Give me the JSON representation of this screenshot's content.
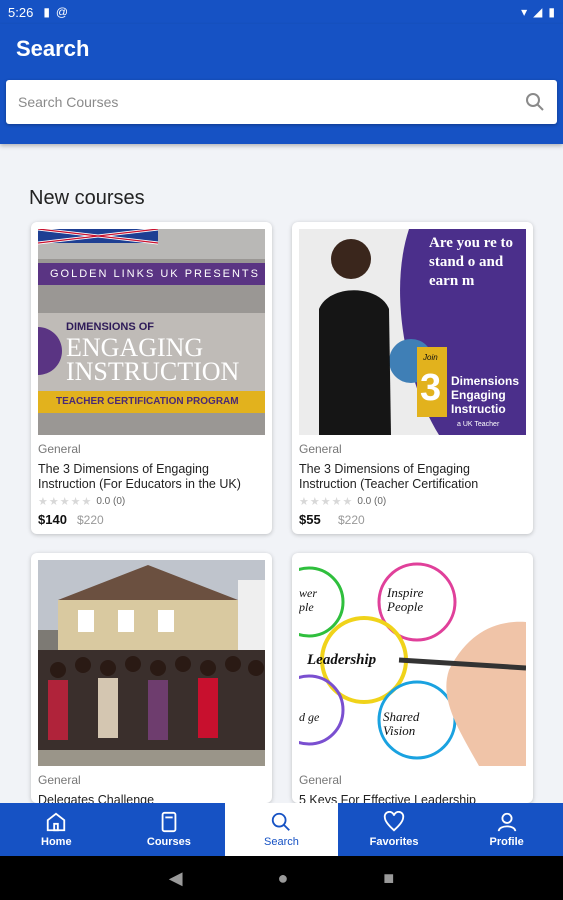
{
  "status": {
    "time": "5:26"
  },
  "header": {
    "title": "Search",
    "search_placeholder": "Search Courses"
  },
  "section": {
    "title": "New courses"
  },
  "courses": [
    {
      "category": "General",
      "title": "The 3 Dimensions of Engaging Instruction (For Educators in the UK)",
      "rating": "0.0 (0)",
      "price": "$140",
      "old_price": "$220",
      "thumb": {
        "banner_top": "GOLDEN LINKS UK PRESENTS",
        "line1": "DIMENSIONS OF",
        "line2": "ENGAGING",
        "line3": "INSTRUCTION",
        "footer": "TEACHER CERTIFICATION PROGRAM"
      }
    },
    {
      "category": "General",
      "title": "The 3 Dimensions of Engaging Instruction (Teacher Certification",
      "rating": "0.0 (0)",
      "price": "$55",
      "old_price": "$220",
      "thumb": {
        "headline": "Are you re to stand o and earn m",
        "join": "Join",
        "num": "3",
        "sub": "Dimensions Engaging Instructio",
        "small": "a UK Teacher"
      }
    },
    {
      "category": "General",
      "title": "Delegates Challenge",
      "thumb": {}
    },
    {
      "category": "General",
      "title": "5 Keys For Effective Leadership",
      "thumb": {
        "w1": "Inspire People",
        "w2": "Leadership",
        "w3": "Shared Vision",
        "w4": "wer ple",
        "w5": "d ge"
      }
    }
  ],
  "nav": [
    {
      "label": "Home",
      "icon": "home-icon"
    },
    {
      "label": "Courses",
      "icon": "book-icon"
    },
    {
      "label": "Search",
      "icon": "search-icon",
      "active": true
    },
    {
      "label": "Favorites",
      "icon": "heart-icon"
    },
    {
      "label": "Profile",
      "icon": "person-icon"
    }
  ],
  "colors": {
    "primary": "#1652c4",
    "background": "#f1f3f7"
  }
}
